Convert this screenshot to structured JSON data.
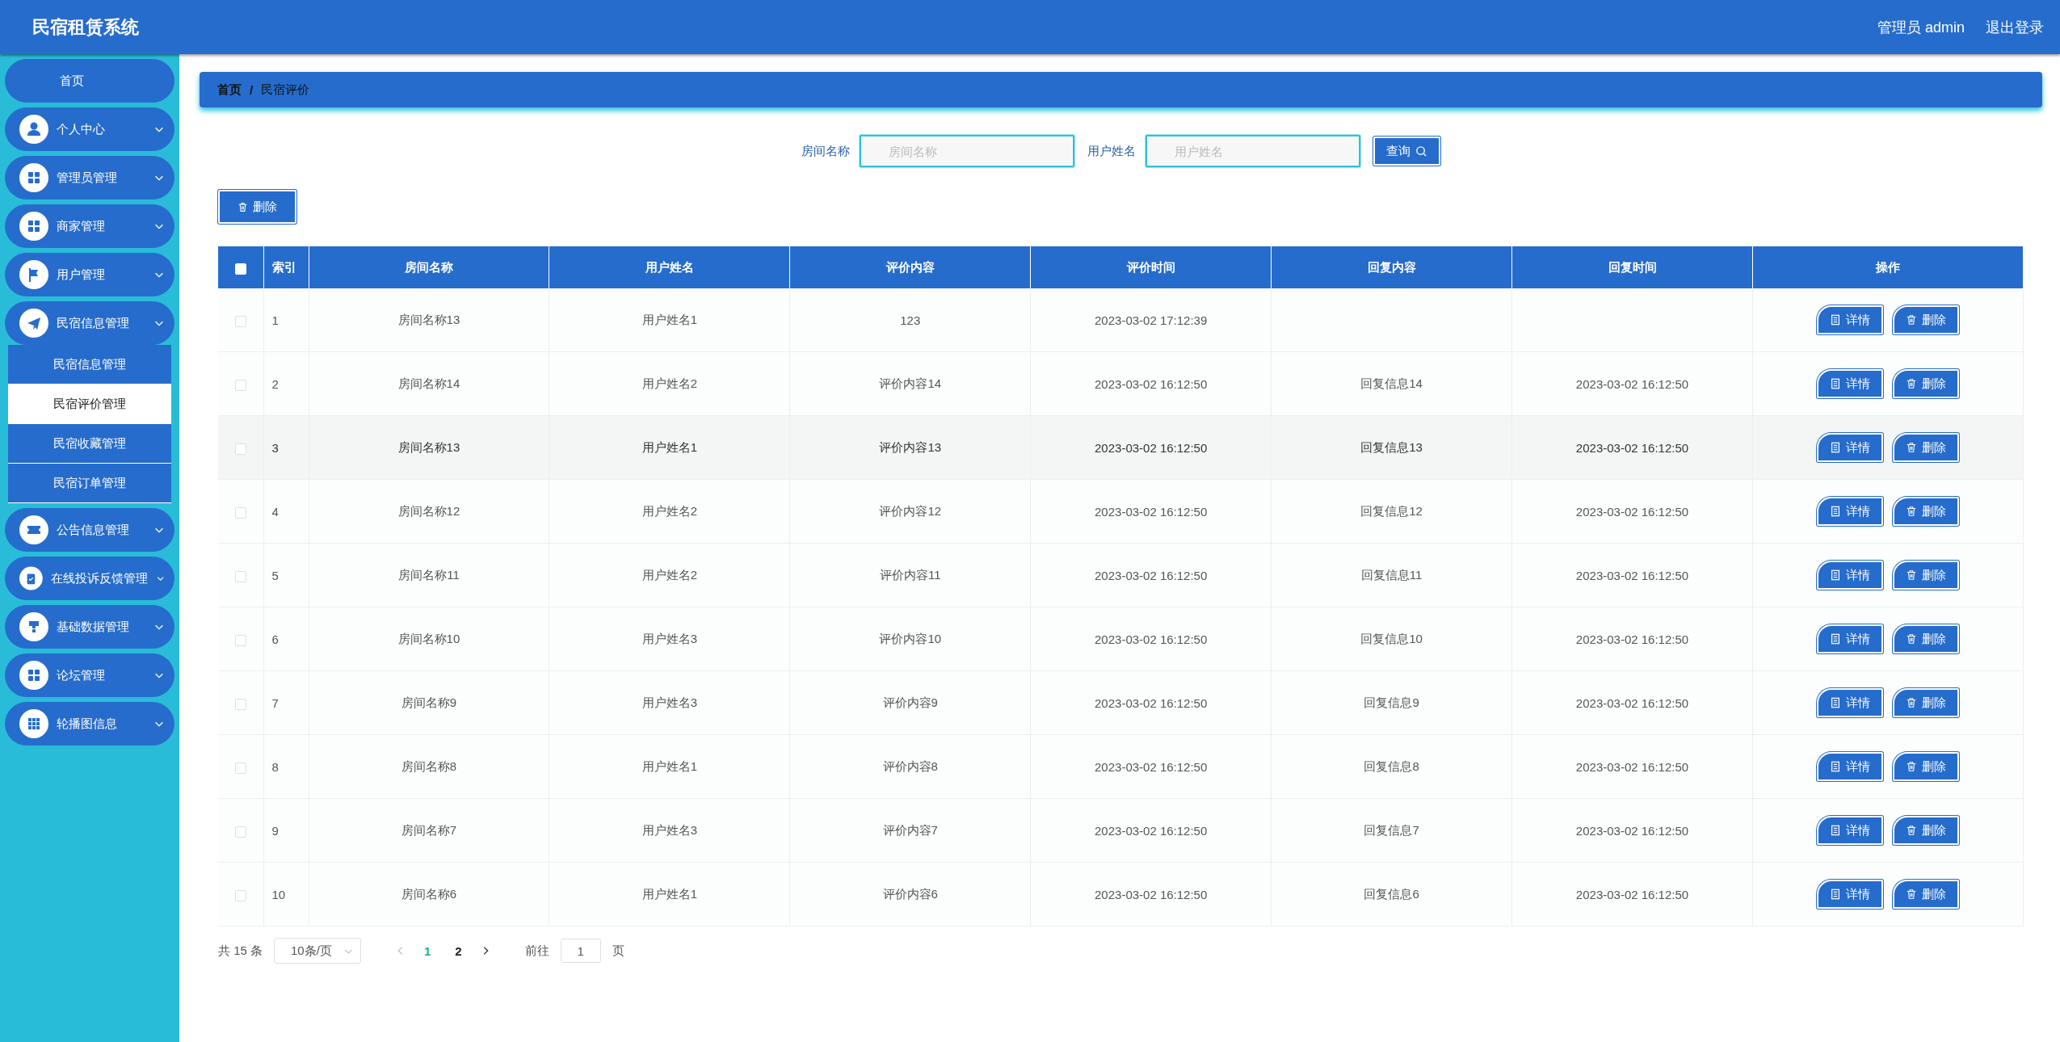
{
  "header": {
    "title": "民宿租赁系统",
    "user": "管理员 admin",
    "logout": "退出登录"
  },
  "sidebar": {
    "items": [
      {
        "kind": "link",
        "label": "首页"
      },
      {
        "kind": "group",
        "label": "个人中心"
      },
      {
        "kind": "group",
        "label": "管理员管理"
      },
      {
        "kind": "group",
        "label": "商家管理"
      },
      {
        "kind": "group",
        "label": "用户管理"
      },
      {
        "kind": "group",
        "label": "民宿信息管理",
        "children": [
          {
            "label": "民宿信息管理",
            "selected": false
          },
          {
            "label": "民宿评价管理",
            "selected": true
          },
          {
            "label": "民宿收藏管理",
            "selected": false
          },
          {
            "label": "民宿订单管理",
            "selected": false
          }
        ]
      },
      {
        "kind": "group",
        "label": "公告信息管理"
      },
      {
        "kind": "group",
        "label": "在线投诉反馈管理"
      },
      {
        "kind": "group",
        "label": "基础数据管理"
      },
      {
        "kind": "group",
        "label": "论坛管理"
      },
      {
        "kind": "group",
        "label": "轮播图信息"
      }
    ]
  },
  "breadcrumb": [
    "首页",
    "/",
    "民宿评价"
  ],
  "search": {
    "fields": [
      {
        "label": "房间名称",
        "placeholder": "房间名称"
      },
      {
        "label": "用户姓名",
        "placeholder": "用户姓名"
      }
    ],
    "button": "查询"
  },
  "toolbar": {
    "delete": "删除"
  },
  "table": {
    "all_checked": false,
    "columns": [
      "索引",
      "房间名称",
      "用户姓名",
      "评价内容",
      "评价时间",
      "回复内容",
      "回复时间",
      "操作"
    ],
    "rows": [
      {
        "checked": false,
        "highlighted": false,
        "cells": [
          "1",
          "房间名称13",
          "用户姓名1",
          "123",
          "2023-03-02 17:12:39"
        ],
        "actions": [
          {
            "kind": "detail",
            "label": "详情"
          },
          {
            "kind": "delete",
            "label": "删除"
          }
        ]
      },
      {
        "checked": false,
        "highlighted": false,
        "cells": [
          "2",
          "房间名称14",
          "用户姓名2",
          "评价内容14",
          "2023-03-02 16:12:50",
          "回复信息14",
          "2023-03-02 16:12:50"
        ],
        "actions": [
          {
            "kind": "detail",
            "label": "详情"
          },
          {
            "kind": "delete",
            "label": "删除"
          }
        ]
      },
      {
        "checked": false,
        "highlighted": true,
        "cells": [
          "3",
          "房间名称13",
          "用户姓名1",
          "评价内容13",
          "2023-03-02 16:12:50",
          "回复信息13",
          "2023-03-02 16:12:50"
        ],
        "actions": [
          {
            "kind": "detail",
            "label": "详情"
          },
          {
            "kind": "delete",
            "label": "删除"
          }
        ]
      },
      {
        "checked": false,
        "highlighted": false,
        "cells": [
          "4",
          "房间名称12",
          "用户姓名2",
          "评价内容12",
          "2023-03-02 16:12:50",
          "回复信息12",
          "2023-03-02 16:12:50"
        ],
        "actions": [
          {
            "kind": "detail",
            "label": "详情"
          },
          {
            "kind": "delete",
            "label": "删除"
          }
        ]
      },
      {
        "checked": false,
        "highlighted": false,
        "cells": [
          "5",
          "房间名称11",
          "用户姓名2",
          "评价内容11",
          "2023-03-02 16:12:50",
          "回复信息11",
          "2023-03-02 16:12:50"
        ],
        "actions": [
          {
            "kind": "detail",
            "label": "详情"
          },
          {
            "kind": "delete",
            "label": "删除"
          }
        ]
      },
      {
        "checked": false,
        "highlighted": false,
        "cells": [
          "6",
          "房间名称10",
          "用户姓名3",
          "评价内容10",
          "2023-03-02 16:12:50",
          "回复信息10",
          "2023-03-02 16:12:50"
        ],
        "actions": [
          {
            "kind": "detail",
            "label": "详情"
          },
          {
            "kind": "delete",
            "label": "删除"
          }
        ]
      },
      {
        "checked": false,
        "highlighted": false,
        "cells": [
          "7",
          "房间名称9",
          "用户姓名3",
          "评价内容9",
          "2023-03-02 16:12:50",
          "回复信息9",
          "2023-03-02 16:12:50"
        ],
        "actions": [
          {
            "kind": "detail",
            "label": "详情"
          },
          {
            "kind": "delete",
            "label": "删除"
          }
        ]
      },
      {
        "checked": false,
        "highlighted": false,
        "cells": [
          "8",
          "房间名称8",
          "用户姓名1",
          "评价内容8",
          "2023-03-02 16:12:50",
          "回复信息8",
          "2023-03-02 16:12:50"
        ],
        "actions": [
          {
            "kind": "detail",
            "label": "详情"
          },
          {
            "kind": "delete",
            "label": "删除"
          }
        ]
      },
      {
        "checked": false,
        "highlighted": false,
        "cells": [
          "9",
          "房间名称7",
          "用户姓名3",
          "评价内容7",
          "2023-03-02 16:12:50",
          "回复信息7",
          "2023-03-02 16:12:50"
        ],
        "actions": [
          {
            "kind": "detail",
            "label": "详情"
          },
          {
            "kind": "delete",
            "label": "删除"
          }
        ]
      },
      {
        "checked": false,
        "highlighted": false,
        "cells": [
          "10",
          "房间名称6",
          "用户姓名1",
          "评价内容6",
          "2023-03-02 16:12:50",
          "回复信息6",
          "2023-03-02 16:12:50"
        ],
        "actions": [
          {
            "kind": "detail",
            "label": "详情"
          },
          {
            "kind": "delete",
            "label": "删除"
          }
        ]
      }
    ]
  },
  "pager": {
    "total": "共 15 条",
    "page_size": "10条/页",
    "prev_disabled": true,
    "next_disabled": false,
    "pages": [
      {
        "label": "1",
        "selected": true
      },
      {
        "label": "2",
        "selected": false
      }
    ],
    "goto_label": "前往",
    "goto_value": "1",
    "goto_suffix": "页"
  }
}
